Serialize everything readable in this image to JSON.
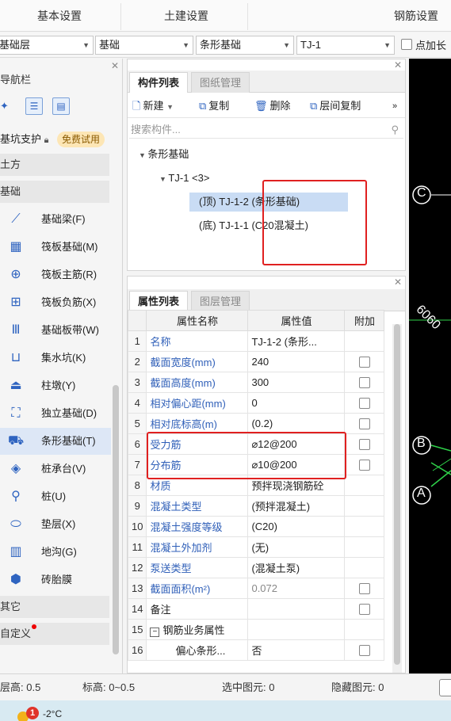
{
  "menubar": {
    "items": [
      "基本设置",
      "土建设置",
      "钢筋设置"
    ]
  },
  "selectors": {
    "floor": "基础层",
    "category": "基础",
    "type": "条形基础",
    "component": "TJ-1",
    "checkbox_label": "点加长"
  },
  "nav": {
    "title": "导航栏",
    "pit_support": "基坑支护",
    "trial_badge": "免费试用",
    "earthwork": "土方",
    "foundation": "基础",
    "items": [
      {
        "label": "基础梁(F)",
        "icon": "beam-icon"
      },
      {
        "label": "筏板基础(M)",
        "icon": "raft-icon"
      },
      {
        "label": "筏板主筋(R)",
        "icon": "raft-main-rebar-icon"
      },
      {
        "label": "筏板负筋(X)",
        "icon": "raft-neg-rebar-icon"
      },
      {
        "label": "基础板带(W)",
        "icon": "strip-band-icon"
      },
      {
        "label": "集水坑(K)",
        "icon": "sump-icon"
      },
      {
        "label": "柱墩(Y)",
        "icon": "pier-icon"
      },
      {
        "label": "独立基础(D)",
        "icon": "isolated-foundation-icon"
      },
      {
        "label": "条形基础(T)",
        "icon": "strip-foundation-icon"
      },
      {
        "label": "桩承台(V)",
        "icon": "pile-cap-icon"
      },
      {
        "label": "桩(U)",
        "icon": "pile-icon"
      },
      {
        "label": "垫层(X)",
        "icon": "cushion-icon"
      },
      {
        "label": "地沟(G)",
        "icon": "trench-icon"
      },
      {
        "label": "砖胎膜",
        "icon": "brick-mold-icon"
      }
    ],
    "other": "其它",
    "custom": "自定义"
  },
  "component_panel": {
    "tabs": [
      "构件列表",
      "图纸管理"
    ],
    "toolbar": {
      "new": "新建",
      "copy": "复制",
      "delete": "删除",
      "floor_copy": "层间复制",
      "more": "»"
    },
    "search_placeholder": "搜索构件...",
    "tree": {
      "root": "条形基础",
      "child": "TJ-1 <3>",
      "leaf1": "(顶) TJ-1-2 (条形基础)",
      "leaf2": "(底) TJ-1-1 (C20混凝土)"
    }
  },
  "property_panel": {
    "tabs": [
      "属性列表",
      "图层管理"
    ],
    "headers": [
      "属性名称",
      "属性值",
      "附加"
    ],
    "rows": [
      {
        "n": "1",
        "name": "名称",
        "value": "TJ-1-2 (条形...",
        "cb": false
      },
      {
        "n": "2",
        "name": "截面宽度(mm)",
        "value": "240",
        "cb": true
      },
      {
        "n": "3",
        "name": "截面高度(mm)",
        "value": "300",
        "cb": true
      },
      {
        "n": "4",
        "name": "相对偏心距(mm)",
        "value": "0",
        "cb": true
      },
      {
        "n": "5",
        "name": "相对底标高(m)",
        "value": "(0.2)",
        "cb": true
      },
      {
        "n": "6",
        "name": "受力筋",
        "value": "⌀12@200",
        "cb": true
      },
      {
        "n": "7",
        "name": "分布筋",
        "value": "⌀10@200",
        "cb": true
      },
      {
        "n": "8",
        "name": "材质",
        "value": "预拌现浇钢筋砼",
        "cb": false
      },
      {
        "n": "9",
        "name": "混凝土类型",
        "value": "(预拌混凝土)",
        "cb": false
      },
      {
        "n": "10",
        "name": "混凝土强度等级",
        "value": "(C20)",
        "cb": false
      },
      {
        "n": "11",
        "name": "混凝土外加剂",
        "value": "(无)",
        "cb": false
      },
      {
        "n": "12",
        "name": "泵送类型",
        "value": "(混凝土泵)",
        "cb": false
      },
      {
        "n": "13",
        "name": "截面面积(m²)",
        "value": "0.072",
        "cb": true
      },
      {
        "n": "14",
        "name": "备注",
        "value": "",
        "cb": true
      },
      {
        "n": "15",
        "name": "钢筋业务属性",
        "value": "",
        "cb": false
      },
      {
        "n": "16",
        "name": "偏心条形...",
        "value": "否",
        "cb": true
      }
    ]
  },
  "canvas": {
    "label_c": "C",
    "label_b": "B",
    "label_a": "A",
    "dimension": "6060"
  },
  "status": {
    "floor_height": "层高:  0.5",
    "elevation": "标高:  0~0.5",
    "selected": "选中图元:  0",
    "hidden": "隐藏图元:  0"
  },
  "taskbar": {
    "notification_count": "1",
    "temperature": "-2°C"
  }
}
